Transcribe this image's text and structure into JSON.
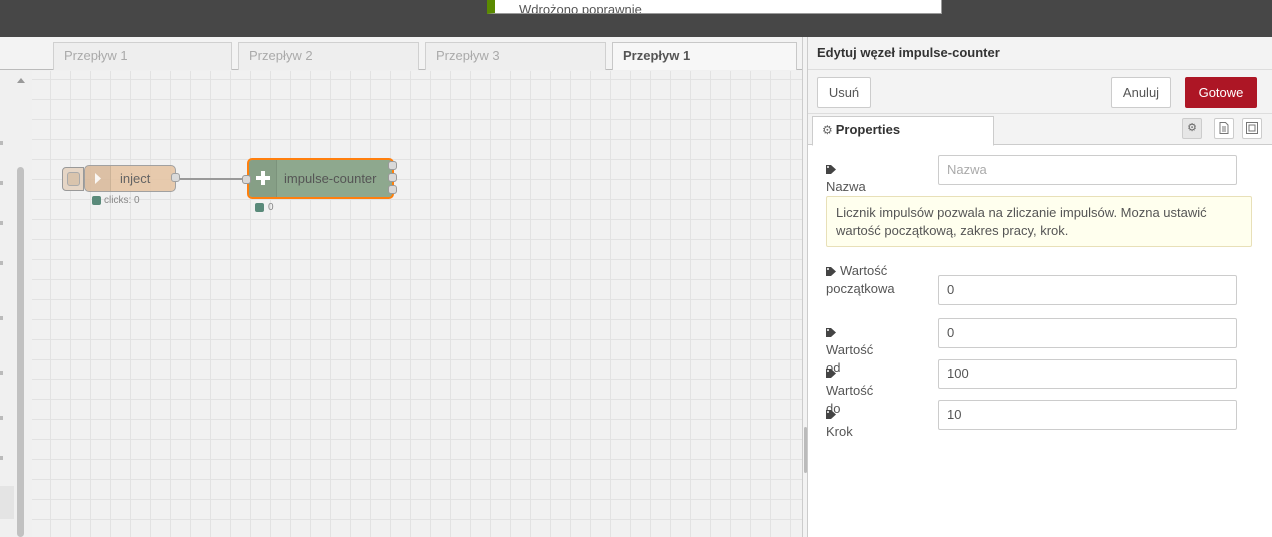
{
  "header": {
    "notification": "Wdrożono poprawnie"
  },
  "workspace": {
    "tabs": [
      {
        "label": "Przepływ 1"
      },
      {
        "label": "Przepływ 2"
      },
      {
        "label": "Przepływ 3"
      },
      {
        "label": "Przepływ 1",
        "active": true
      }
    ],
    "nodes": {
      "inject": {
        "label": "inject",
        "status": "clicks: 0"
      },
      "impulse_counter": {
        "label": "impulse-counter",
        "status": "0",
        "selected_color": "#ff7f0e"
      }
    }
  },
  "editor": {
    "title": "Edytuj węzeł impulse-counter",
    "buttons": {
      "delete": "Usuń",
      "cancel": "Anuluj",
      "done": "Gotowe"
    },
    "tab": {
      "label": "Properties",
      "icon": "gear-icon"
    },
    "side_icons": [
      "gear-icon",
      "document-icon",
      "frame-icon"
    ],
    "fields": {
      "name": {
        "label": "Nazwa",
        "placeholder": "Nazwa",
        "value": ""
      },
      "start_value": {
        "label_line1": "Wartość",
        "label_line2": "początkowa",
        "value": "0"
      },
      "value_from": {
        "label": "Wartość od",
        "value": "0"
      },
      "value_to": {
        "label": "Wartość do",
        "value": "100"
      },
      "step": {
        "label": "Krok",
        "value": "10"
      }
    },
    "tip_line1": "Licznik impulsów pozwala na zliczanie impulsów. Mozna ustawić",
    "tip_line2": "wartość początkową, zakres pracy, krok."
  },
  "colors": {
    "header_bg": "#474747",
    "done_button": "#ad1625",
    "inject_node": "#e6c6a6",
    "counter_node": "#8ea88e",
    "status_dot": "#5a8a7a"
  }
}
